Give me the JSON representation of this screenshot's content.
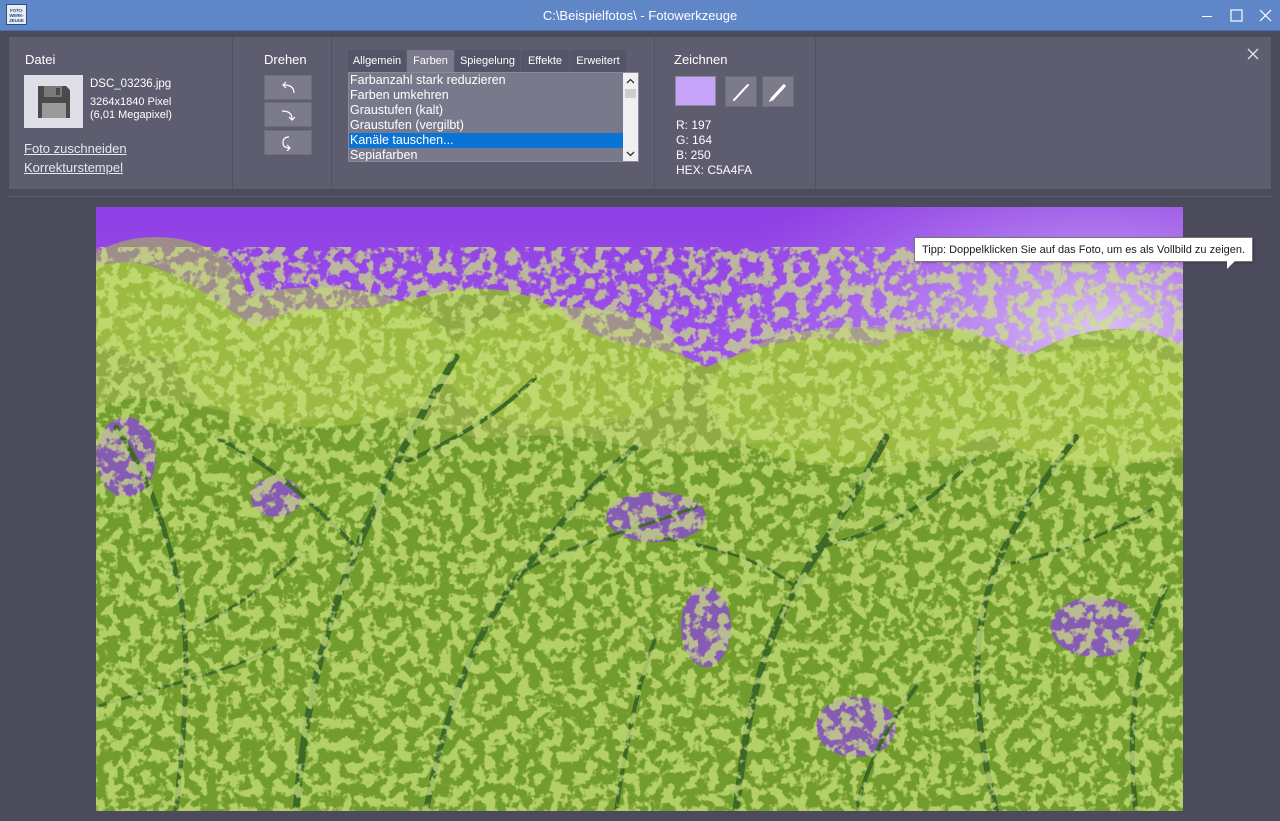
{
  "window": {
    "app_icon_text": "FOTO-WERK-ZEUGE",
    "title": "C:\\Beispielfotos\\ - Fotowerkzeuge"
  },
  "file": {
    "section_title": "Datei",
    "filename": "DSC_03236.jpg",
    "dimensions": "3264x1840 Pixel",
    "megapixels": "(6,01 Megapixel)",
    "crop_link": "Foto zuschneiden",
    "stamp_link": "Korrekturstempel",
    "icon": "floppy-disk-icon"
  },
  "rotate": {
    "section_title": "Drehen",
    "buttons": [
      "rotate-left-icon",
      "rotate-right-icon",
      "rotate-180-icon"
    ]
  },
  "filters": {
    "tabs": [
      {
        "label": "Allgemein",
        "active": false
      },
      {
        "label": "Farben",
        "active": true
      },
      {
        "label": "Spiegelung",
        "active": false
      },
      {
        "label": "Effekte",
        "active": false
      },
      {
        "label": "Erweitert",
        "active": false
      }
    ],
    "items": [
      {
        "label": "Farbanzahl stark reduzieren",
        "selected": false
      },
      {
        "label": "Farben umkehren",
        "selected": false
      },
      {
        "label": "Graustufen (kalt)",
        "selected": false
      },
      {
        "label": "Graustufen (vergilbt)",
        "selected": false
      },
      {
        "label": "Kanäle tauschen...",
        "selected": true
      },
      {
        "label": "Sepiafarben",
        "selected": false
      }
    ]
  },
  "draw": {
    "section_title": "Zeichnen",
    "color_hex": "#C5A4FA",
    "r": "R: 197",
    "g": "G: 164",
    "b": "B: 250",
    "hex": "HEX: C5A4FA",
    "tools": [
      "pen-icon",
      "pencil-icon"
    ]
  },
  "photo": {
    "tooltip": "Tipp: Doppelklicken Sie auf das Foto, um es als Vollbild zu zeigen."
  },
  "colors": {
    "titlebar": "#5F86C7",
    "background": "#4B4B5C",
    "panel": "#5D5D6F",
    "selection": "#0A74D6"
  }
}
